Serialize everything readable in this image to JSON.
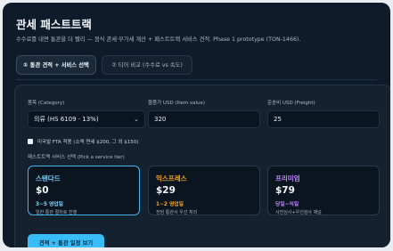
{
  "header": {
    "title": "관세 패스트트랙",
    "subtitle": "수수료를 내면 통관을 더 빨리 — 정식 관세·부가세 계산 + 패스트트랙 서비스 견적. Phase 1 prototype (TON-1466)."
  },
  "tabs": [
    {
      "label": "① 통관 견적 + 서비스 선택",
      "active": true
    },
    {
      "label": "② 티어 비교 (수수료 vs 속도)",
      "active": false
    }
  ],
  "form": {
    "category_label": "품목 (Category)",
    "category_value": "의류 (HS 6109 · 13%)",
    "item_value_label": "물품가 USD (Item value)",
    "item_value": "320",
    "freight_label": "운송비 USD (Freight)",
    "freight_value": "25",
    "fta_label": "미국발 FTA 적용 (소액 면세 $200, 그 외 $150)",
    "fta_checked": false,
    "tier_label": "패스트트랙 서비스 선택 (Pick a service tier)"
  },
  "tiers": [
    {
      "name": "스탠다드",
      "price": "$0",
      "days": "3~5 영업일",
      "desc": "일반 통관 절차로 진행",
      "selected": true
    },
    {
      "name": "익스프레스",
      "price": "$29",
      "days": "1~2 영업일",
      "desc": "전담 통관사 우선 처리",
      "selected": false
    },
    {
      "name": "프리미엄",
      "price": "$79",
      "days": "당일~익일",
      "desc": "사전심사+우선검사 채널",
      "selected": false
    }
  ],
  "colors": {
    "accent": "#38bdf8",
    "standard": "#7dd3fc",
    "express": "#f5a524",
    "premium": "#c084fc"
  },
  "cta_label": "견적 + 통관 일정 보기",
  "icons": {
    "category_select": "chevron-down-icon"
  }
}
